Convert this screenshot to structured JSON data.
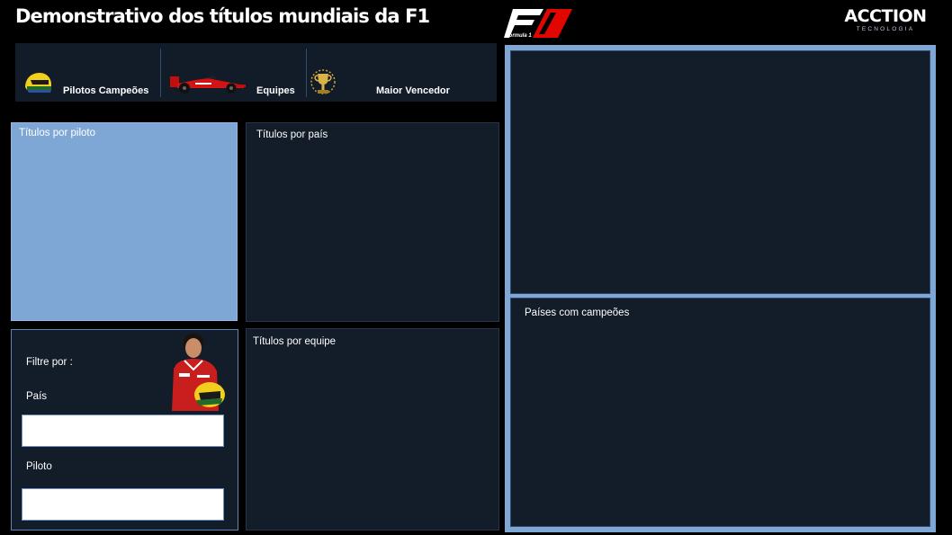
{
  "header": {
    "title": "Demonstrativo dos títulos mundiais da F1",
    "f1_logo_sub": "Formula 1",
    "brand_name": "ACCTION",
    "brand_sub": "TECNOLOGIA"
  },
  "kpis": [
    {
      "label": "Pilotos Campeões",
      "icon": "helmet-icon"
    },
    {
      "label": "Equipes",
      "icon": "race-car-icon"
    },
    {
      "label": "Maior Vencedor",
      "icon": "trophy-icon"
    }
  ],
  "panels": {
    "titulos_por_piloto": "Títulos por piloto",
    "titulos_por_pais": "Títulos por país",
    "titulos_por_equipe": "Títulos por equipe",
    "paises_com_campeoes": "Países com campeões"
  },
  "filters": {
    "title": "Filtre por :",
    "pais_label": "País",
    "pais_value": "",
    "piloto_label": "Piloto",
    "piloto_value": ""
  },
  "colors": {
    "background": "#000000",
    "panel": "#131c29",
    "accent": "#7fa7d6",
    "f1_red": "#e10600"
  }
}
